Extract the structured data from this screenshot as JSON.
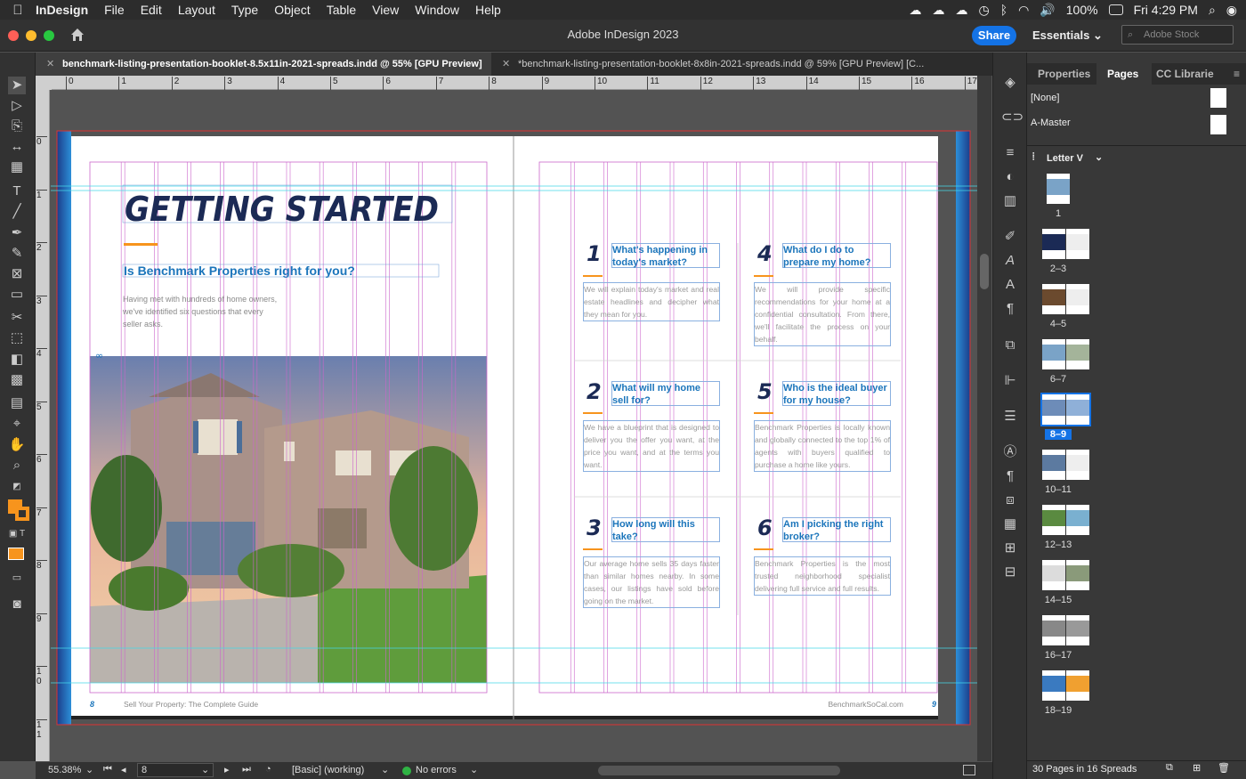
{
  "menubar": {
    "app": "InDesign",
    "items": [
      "File",
      "Edit",
      "Layout",
      "Type",
      "Object",
      "Table",
      "View",
      "Window",
      "Help"
    ],
    "battery": "100%",
    "clock": "Fri 4:29 PM"
  },
  "window": {
    "title": "Adobe InDesign 2023",
    "share": "Share",
    "workspace": "Essentials",
    "stock_placeholder": "Adobe Stock"
  },
  "tabs": [
    {
      "label": "benchmark-listing-presentation-booklet-8.5x11in-2021-spreads.indd @ 55% [GPU Preview]",
      "active": true
    },
    {
      "label": "*benchmark-listing-presentation-booklet-8x8in-2021-spreads.indd @ 59% [GPU Preview] [C...",
      "active": false
    }
  ],
  "ruler": {
    "h": [
      "0",
      "1",
      "2",
      "3",
      "4",
      "5",
      "6",
      "7",
      "8",
      "9",
      "10",
      "11",
      "12",
      "13",
      "14",
      "15",
      "16",
      "17"
    ],
    "v": [
      "0",
      "1",
      "2",
      "3",
      "4",
      "5",
      "6",
      "7",
      "8",
      "9",
      "1 0",
      "1 1"
    ]
  },
  "document": {
    "heading": "GETTING STARTED",
    "subheading": "Is Benchmark Properties right for you?",
    "intro": "Having met with hundreds of home owners, we've identified six questions that every seller asks.",
    "questions": [
      {
        "num": "1",
        "title": "What's happening in today's market?",
        "body": "We will explain today's market and real estate headlines and decipher what they mean for you."
      },
      {
        "num": "4",
        "title": "What do I do to prepare my home?",
        "body": "We will provide specific recommendations for your home at a confidential consultation. From there, we'll facilitate the process on your behalf."
      },
      {
        "num": "2",
        "title": "What will my home sell for?",
        "body": "We have a blueprint that is designed to deliver you the offer you want, at the price you want, and at the terms you want."
      },
      {
        "num": "5",
        "title": "Who is the ideal buyer for my house?",
        "body": "Benchmark Properties is locally known and globally connected to the top 1% of agents with buyers qualified to purchase a home like yours."
      },
      {
        "num": "3",
        "title": "How long will this take?",
        "body": "Our average home sells 35 days faster than similar homes nearby. In some cases, our listings have sold before going on the market."
      },
      {
        "num": "6",
        "title": "Am I picking the right broker?",
        "body": "Benchmark Properties is the most trusted neighborhood specialist delivering full service and full results."
      }
    ],
    "footer_left_num": "8",
    "footer_left_text": "Sell Your Property: The Complete Guide",
    "footer_right_text": "BenchmarkSoCal.com",
    "footer_right_num": "9"
  },
  "status": {
    "zoom": "55.38%",
    "page": "8",
    "style": "[Basic] (working)",
    "errors": "No errors"
  },
  "panel": {
    "tabs": [
      "Properties",
      "Pages",
      "CC Librarie"
    ],
    "masters": [
      "[None]",
      "A-Master"
    ],
    "master_select": "Letter V",
    "pages": [
      "1",
      "2–3",
      "4–5",
      "6–7",
      "8–9",
      "10–11",
      "12–13",
      "14–15",
      "16–17",
      "18–19"
    ],
    "selected": "8–9",
    "footer": "30 Pages in 16 Spreads"
  },
  "colors": {
    "accent": "#1473e6",
    "brand_navy": "#1b2a55",
    "brand_blue": "#1b75bb",
    "brand_orange": "#f7941d",
    "guide_magenta": "#cc66cc",
    "guide_cyan": "#44d8e8"
  }
}
